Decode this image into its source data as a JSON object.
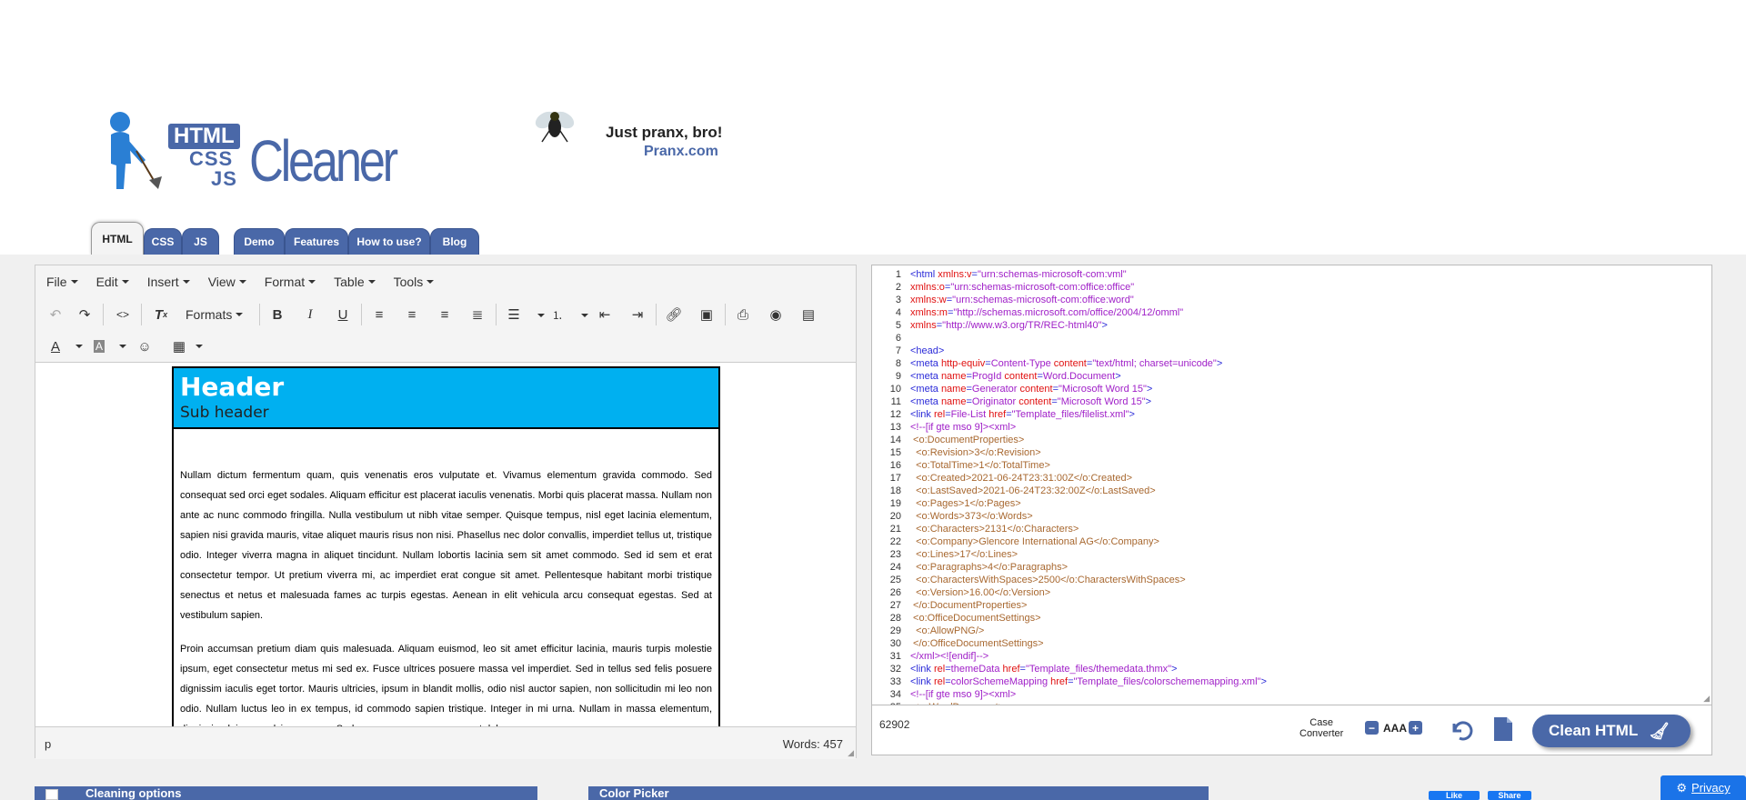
{
  "logo": {
    "badge": "HTML",
    "css": "CSS",
    "js": "JS",
    "word": "Cleaner"
  },
  "ad": {
    "line1": "Just pranx, bro!",
    "line2": "Pranx.com"
  },
  "tabs": [
    "HTML",
    "CSS",
    "JS",
    "Demo",
    "Features",
    "How to use?",
    "Blog"
  ],
  "editor": {
    "menus": [
      "File",
      "Edit",
      "Insert",
      "View",
      "Format",
      "Table",
      "Tools"
    ],
    "formats_label": "Formats",
    "doc": {
      "header": "Header",
      "subheader": "Sub header",
      "para1": "Nullam dictum fermentum quam, quis venenatis eros vulputate et. Vivamus elementum gravida commodo. Sed consequat sed orci eget sodales. Aliquam efficitur est placerat iaculis venenatis. Morbi quis placerat massa. Nullam non ante ac nunc commodo fringilla. Nulla vestibulum ut nibh vitae semper. Quisque tempus, nisl eget lacinia elementum, sapien nisi gravida mauris, vitae aliquet mauris risus non nisi. Phasellus nec dolor convallis, imperdiet tellus ut, tristique odio. Integer viverra magna in aliquet tincidunt. Nullam lobortis lacinia sem sit amet commodo. Sed id sem et erat consectetur tempor. Ut pretium viverra mi, ac imperdiet erat congue sit amet. Pellentesque habitant morbi tristique senectus et netus et malesuada fames ac turpis egestas. Aenean in elit vehicula arcu consequat egestas. Sed at vestibulum sapien.",
      "para2": "Proin accumsan pretium diam quis malesuada. Aliquam euismod, leo sit amet efficitur lacinia, mauris turpis molestie ipsum, eget consectetur metus mi sed ex. Fusce ultrices posuere massa vel imperdiet. Sed in tellus sed felis posuere dignissim iaculis eget tortor. Mauris ultricies, ipsum in blandit mollis, odio nisl auctor sapien, non sollicitudin mi leo non odio. Nullam luctus leo in ex tempus, id commodo sapien tristique. Integer in mi urna. Nullam in massa elementum, dignissim dui nec, pulvinar magna. Sed accumsan augue consequat dolor"
    },
    "status_path": "p",
    "word_count": "Words: 457"
  },
  "code": {
    "lines": [
      [
        [
          "tg",
          "<html "
        ],
        [
          "at",
          "xmlns:v"
        ],
        [
          "tg",
          "="
        ],
        [
          "vl",
          "\"urn:schemas-microsoft-com:vml\""
        ]
      ],
      [
        [
          "at",
          "xmlns:o"
        ],
        [
          "tg",
          "="
        ],
        [
          "vl",
          "\"urn:schemas-microsoft-com:office:office\""
        ]
      ],
      [
        [
          "at",
          "xmlns:w"
        ],
        [
          "tg",
          "="
        ],
        [
          "vl",
          "\"urn:schemas-microsoft-com:office:word\""
        ]
      ],
      [
        [
          "at",
          "xmlns:m"
        ],
        [
          "tg",
          "="
        ],
        [
          "vl",
          "\"http://schemas.microsoft.com/office/2004/12/omml\""
        ]
      ],
      [
        [
          "at",
          "xmlns"
        ],
        [
          "tg",
          "="
        ],
        [
          "vl",
          "\"http://www.w3.org/TR/REC-html40\""
        ],
        [
          "tg",
          ">"
        ]
      ],
      [],
      [
        [
          "tg",
          "<head>"
        ]
      ],
      [
        [
          "tg",
          "<meta "
        ],
        [
          "at",
          "http-equiv"
        ],
        [
          "tg",
          "="
        ],
        [
          "vl",
          "Content-Type "
        ],
        [
          "at",
          "content"
        ],
        [
          "tg",
          "="
        ],
        [
          "vl",
          "\"text/html; charset=unicode\""
        ],
        [
          "tg",
          ">"
        ]
      ],
      [
        [
          "tg",
          "<meta "
        ],
        [
          "at",
          "name"
        ],
        [
          "tg",
          "="
        ],
        [
          "vl",
          "ProgId "
        ],
        [
          "at",
          "content"
        ],
        [
          "tg",
          "="
        ],
        [
          "vl",
          "Word.Document"
        ],
        [
          "tg",
          ">"
        ]
      ],
      [
        [
          "tg",
          "<meta "
        ],
        [
          "at",
          "name"
        ],
        [
          "tg",
          "="
        ],
        [
          "vl",
          "Generator "
        ],
        [
          "at",
          "content"
        ],
        [
          "tg",
          "="
        ],
        [
          "vl",
          "\"Microsoft Word 15\""
        ],
        [
          "tg",
          ">"
        ]
      ],
      [
        [
          "tg",
          "<meta "
        ],
        [
          "at",
          "name"
        ],
        [
          "tg",
          "="
        ],
        [
          "vl",
          "Originator "
        ],
        [
          "at",
          "content"
        ],
        [
          "tg",
          "="
        ],
        [
          "vl",
          "\"Microsoft Word 15\""
        ],
        [
          "tg",
          ">"
        ]
      ],
      [
        [
          "tg",
          "<link "
        ],
        [
          "at",
          "rel"
        ],
        [
          "tg",
          "="
        ],
        [
          "vl",
          "File-List "
        ],
        [
          "at",
          "href"
        ],
        [
          "tg",
          "="
        ],
        [
          "vl",
          "\"Template_files/filelist.xml\""
        ],
        [
          "tg",
          ">"
        ]
      ],
      [
        [
          "vl",
          "<!--[if gte mso 9]><xml>"
        ]
      ],
      [
        [
          "cm",
          " <o:DocumentProperties>"
        ]
      ],
      [
        [
          "cm",
          "  <o:Revision>3</o:Revision>"
        ]
      ],
      [
        [
          "cm",
          "  <o:TotalTime>1</o:TotalTime>"
        ]
      ],
      [
        [
          "cm",
          "  <o:Created>2021-06-24T23:31:00Z</o:Created>"
        ]
      ],
      [
        [
          "cm",
          "  <o:LastSaved>2021-06-24T23:32:00Z</o:LastSaved>"
        ]
      ],
      [
        [
          "cm",
          "  <o:Pages>1</o:Pages>"
        ]
      ],
      [
        [
          "cm",
          "  <o:Words>373</o:Words>"
        ]
      ],
      [
        [
          "cm",
          "  <o:Characters>2131</o:Characters>"
        ]
      ],
      [
        [
          "cm",
          "  <o:Company>Glencore International AG</o:Company>"
        ]
      ],
      [
        [
          "cm",
          "  <o:Lines>17</o:Lines>"
        ]
      ],
      [
        [
          "cm",
          "  <o:Paragraphs>4</o:Paragraphs>"
        ]
      ],
      [
        [
          "cm",
          "  <o:CharactersWithSpaces>2500</o:CharactersWithSpaces>"
        ]
      ],
      [
        [
          "cm",
          "  <o:Version>16.00</o:Version>"
        ]
      ],
      [
        [
          "cm",
          " </o:DocumentProperties>"
        ]
      ],
      [
        [
          "cm",
          " <o:OfficeDocumentSettings>"
        ]
      ],
      [
        [
          "cm",
          "  <o:AllowPNG/>"
        ]
      ],
      [
        [
          "cm",
          " </o:OfficeDocumentSettings>"
        ]
      ],
      [
        [
          "vl",
          "</xml><![endif]-->"
        ]
      ],
      [
        [
          "tg",
          "<link "
        ],
        [
          "at",
          "rel"
        ],
        [
          "tg",
          "="
        ],
        [
          "vl",
          "themeData "
        ],
        [
          "at",
          "href"
        ],
        [
          "tg",
          "="
        ],
        [
          "vl",
          "\"Template_files/themedata.thmx\""
        ],
        [
          "tg",
          ">"
        ]
      ],
      [
        [
          "tg",
          "<link "
        ],
        [
          "at",
          "rel"
        ],
        [
          "tg",
          "="
        ],
        [
          "vl",
          "colorSchemeMapping "
        ],
        [
          "at",
          "href"
        ],
        [
          "tg",
          "="
        ],
        [
          "vl",
          "\"Template_files/colorschememapping.xml\""
        ],
        [
          "tg",
          ">"
        ]
      ],
      [
        [
          "vl",
          "<!--[if gte mso 9]><xml>"
        ]
      ],
      [
        [
          "cm",
          " <w:WordDocument>"
        ]
      ]
    ],
    "char_count": "62902",
    "case_converter": "Case\nConverter",
    "aaa_label": "AAA",
    "clean_button": "Clean HTML"
  },
  "bottom": {
    "cleaning_options": "Cleaning options",
    "color_picker": "Color Picker",
    "privacy": "Privacy",
    "fb_like": "Like",
    "fb_share": "Share"
  },
  "colors": {
    "brand": "#4a68a8",
    "header_bg": "#00b0f0",
    "privacy": "#1a73e8"
  }
}
